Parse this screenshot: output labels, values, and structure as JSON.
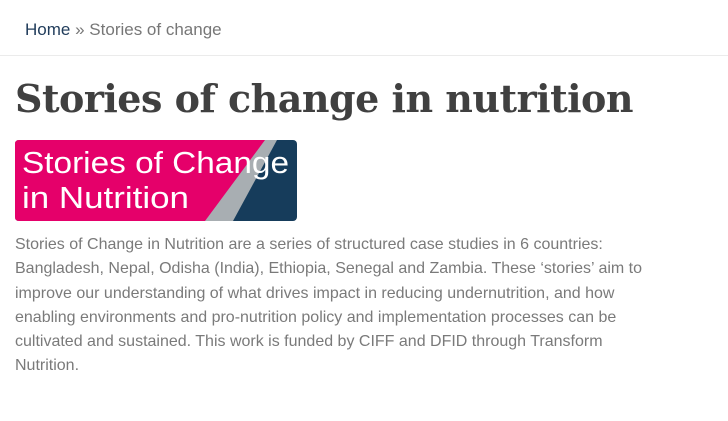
{
  "breadcrumb": {
    "home_label": "Home",
    "separator": "»",
    "current_label": "Stories of change"
  },
  "page": {
    "title": "Stories of change in nutrition"
  },
  "banner": {
    "line1": "Stories of Change",
    "line2": "in Nutrition",
    "colors": {
      "pink": "#e5006a",
      "navy": "#163c5b",
      "gray": "#a8aeb2"
    }
  },
  "content": {
    "lines": [
      "Stories of Change in Nutrition are a series of structured case studies in 6 countries:",
      "Bangladesh, Nepal, Odisha (India), Ethiopia, Senegal and Zambia. These ‘stories’ aim to",
      "improve our understanding of what drives impact in reducing undernutrition, and how",
      "enabling environments and pro-nutrition policy and implementation processes can be",
      "cultivated and sustained. This work is funded by CIFF and DFID through Transform",
      "Nutrition."
    ]
  }
}
